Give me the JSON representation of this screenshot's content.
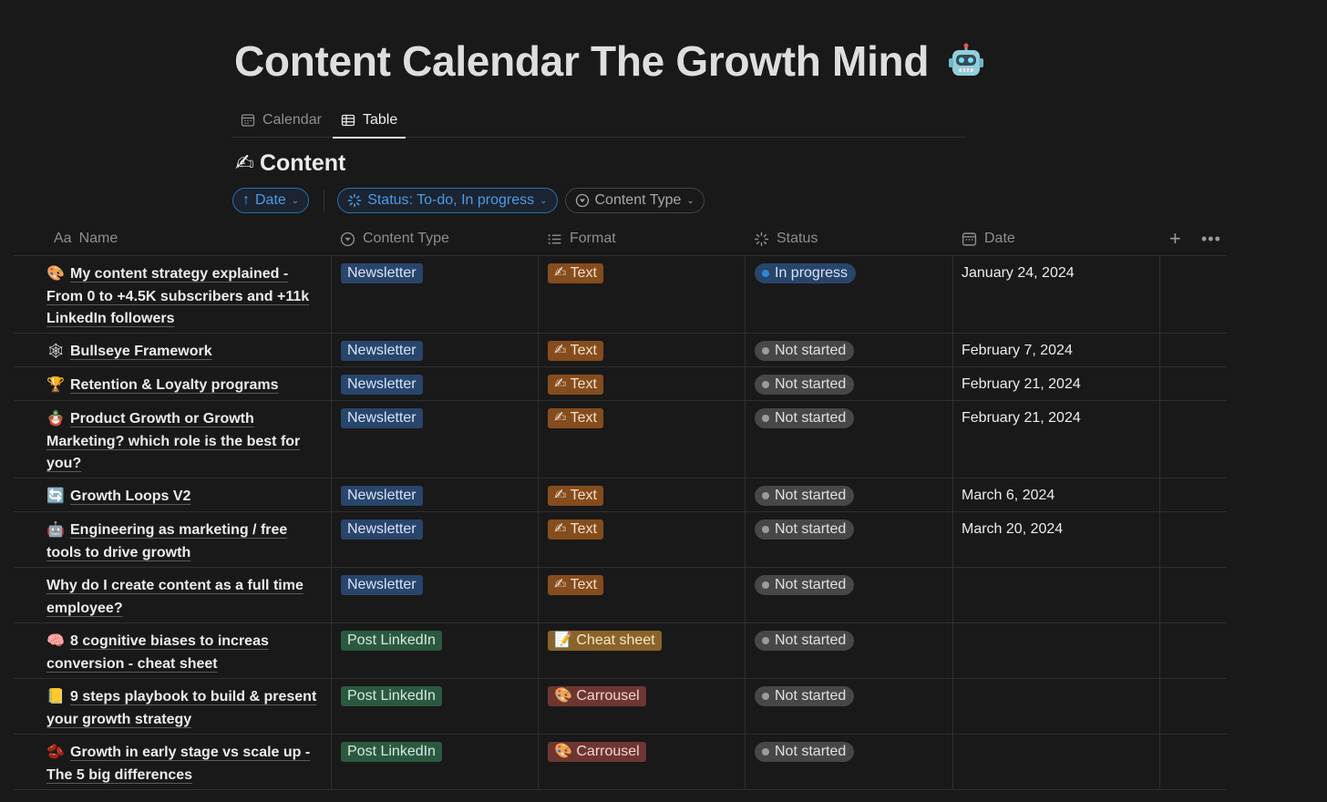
{
  "page": {
    "title": "Content Calendar The Growth Mind",
    "title_emoji": "robot-icon"
  },
  "tabs": [
    {
      "label": "Calendar",
      "icon": "calendar-icon",
      "active": false
    },
    {
      "label": "Table",
      "icon": "table-icon",
      "active": true
    }
  ],
  "section": {
    "emoji": "✍",
    "title": "Content"
  },
  "filters": {
    "sort_label": "Date",
    "status_label": "Status: To-do, In progress",
    "type_label": "Content Type"
  },
  "columns": {
    "name_prefix": "Aa",
    "name": "Name",
    "content_type": "Content Type",
    "format": "Format",
    "status": "Status",
    "date": "Date"
  },
  "rows": [
    {
      "icon": "🎨",
      "name": "My content strategy explained - From 0 to +4.5K subscribers and +11k LinkedIn followers",
      "type": "Newsletter",
      "format": "Text",
      "format_icon": "✍",
      "status": "In progress",
      "date": "January 24, 2024"
    },
    {
      "icon": "🕸",
      "name": "Bullseye Framework",
      "type": "Newsletter",
      "format": "Text",
      "format_icon": "✍",
      "status": "Not started",
      "date": "February 7, 2024"
    },
    {
      "icon": "🏆",
      "name": "Retention & Loyalty programs",
      "type": "Newsletter",
      "format": "Text",
      "format_icon": "✍",
      "status": "Not started",
      "date": "February 21, 2024"
    },
    {
      "icon": "🪆",
      "name": "Product Growth or Growth Marketing? which role is the best for you?",
      "type": "Newsletter",
      "format": "Text",
      "format_icon": "✍",
      "status": "Not started",
      "date": "February 21, 2024"
    },
    {
      "icon": "🔄",
      "name": "Growth Loops V2",
      "type": "Newsletter",
      "format": "Text",
      "format_icon": "✍",
      "status": "Not started",
      "date": "March 6, 2024"
    },
    {
      "icon": "🤖",
      "name": "Engineering as marketing / free tools to drive growth",
      "type": "Newsletter",
      "format": "Text",
      "format_icon": "✍",
      "status": "Not started",
      "date": "March 20, 2024"
    },
    {
      "icon": "",
      "name": "Why do I create content as a full time employee?",
      "type": "Newsletter",
      "format": "Text",
      "format_icon": "✍",
      "status": "Not started",
      "date": ""
    },
    {
      "icon": "🧠",
      "name": "8 cognitive biases to increas conversion - cheat sheet",
      "type": "Post LinkedIn",
      "format": "Cheat sheet",
      "format_icon": "📝",
      "status": "Not started",
      "date": ""
    },
    {
      "icon": "📒",
      "name": "9 steps playbook to build & present your growth strategy",
      "type": "Post LinkedIn",
      "format": "Carrousel",
      "format_icon": "🎨",
      "status": "Not started",
      "date": ""
    },
    {
      "icon": "🫘",
      "name": "Growth in early stage vs scale up - The 5 big differences",
      "type": "Post LinkedIn",
      "format": "Carrousel",
      "format_icon": "🎨",
      "status": "Not started",
      "date": ""
    }
  ],
  "colors": {
    "background": "#191919",
    "newsletter": "#28456c",
    "post_linkedin": "#2b593f",
    "text_format": "#854c1d",
    "cheat_sheet": "#89632a",
    "carrousel": "#6e3630",
    "filter_accent": "#4a9be8"
  }
}
